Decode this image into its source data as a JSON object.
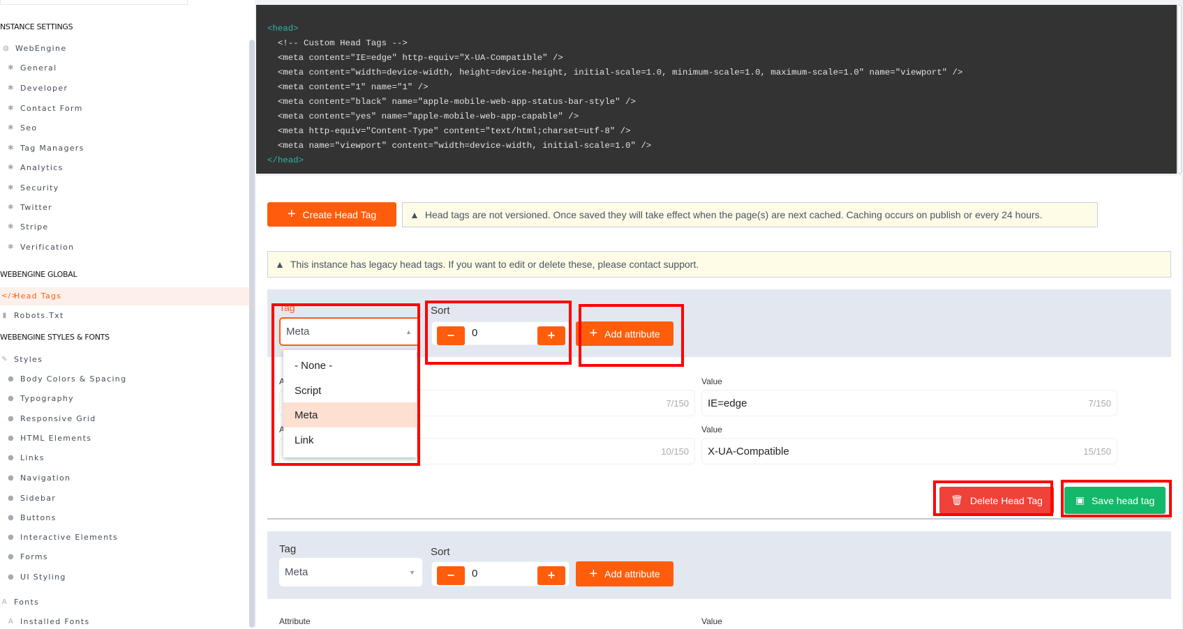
{
  "sidebar": {
    "sections": [
      {
        "title": "NSTANCE SETTINGS"
      },
      {
        "title": "WEBENGINE GLOBAL"
      },
      {
        "title": "WEBENGINE STYLES & FONTS"
      }
    ],
    "instance_items": [
      "WebEngine",
      "General",
      "Developer",
      "Contact Form",
      "Seo",
      "Tag Managers",
      "Analytics",
      "Security",
      "Twitter",
      "Stripe",
      "Verification"
    ],
    "global_items": [
      "Head Tags",
      "Robots.Txt"
    ],
    "style_items": [
      "Styles",
      "Body Colors & Spacing",
      "Typography",
      "Responsive Grid",
      "HTML Elements",
      "Links",
      "Navigation",
      "Sidebar",
      "Buttons",
      "Interactive Elements",
      "Forms",
      "UI Styling",
      "Fonts",
      "Installed Fonts"
    ],
    "active": "Head Tags"
  },
  "code": {
    "open": "<head>",
    "lines": [
      "  <!-- Custom Head Tags -->",
      "  <meta content=\"IE=edge\" http-equiv=\"X-UA-Compatible\" />",
      "  <meta content=\"width=device-width, height=device-height, initial-scale=1.0, minimum-scale=1.0, maximum-scale=1.0\" name=\"viewport\" />",
      "  <meta content=\"1\" name=\"1\" />",
      "  <meta content=\"black\" name=\"apple-mobile-web-app-status-bar-style\" />",
      "  <meta content=\"yes\" name=\"apple-mobile-web-app-capable\" />",
      "  <meta http-equiv=\"Content-Type\" content=\"text/html;charset=utf-8\" />",
      "  <meta name=\"viewport\" content=\"width=device-width, initial-scale=1.0\" />"
    ],
    "close": "</head>"
  },
  "toolbar": {
    "create_label": "Create Head Tag",
    "notice": "Head tags are not versioned. Once saved they will take effect when the page(s) are next cached. Caching occurs on publish or every 24 hours."
  },
  "legacy_notice": "This instance has legacy head tags. If you want to edit or delete these, please contact support.",
  "card1": {
    "tag_label": "Tag",
    "tag_value": "Meta",
    "sort_label": "Sort",
    "sort_value": "0",
    "add_attribute": "Add attribute",
    "dropdown_options": [
      "- None -",
      "Script",
      "Meta",
      "Link"
    ],
    "dropdown_selected": "Meta",
    "rows": [
      {
        "attr_label": "A",
        "attr_counter": "7/150",
        "value_label": "Value",
        "value": "IE=edge",
        "value_counter": "7/150"
      },
      {
        "attr_label": "A",
        "attr_counter": "10/150",
        "value_label": "Value",
        "value": "X-UA-Compatible",
        "value_counter": "15/150"
      }
    ],
    "delete_label": "Delete Head Tag",
    "save_label": "Save head tag"
  },
  "card2": {
    "tag_label": "Tag",
    "tag_value": "Meta",
    "sort_label": "Sort",
    "sort_value": "0",
    "add_attribute": "Add attribute",
    "attr_label": "Attribute",
    "value_label": "Value"
  },
  "colors": {
    "accent": "#ff5d0c",
    "danger": "#ef4238",
    "success": "#14b86a",
    "notice_bg": "#fefce6",
    "code_bg": "#333333"
  }
}
